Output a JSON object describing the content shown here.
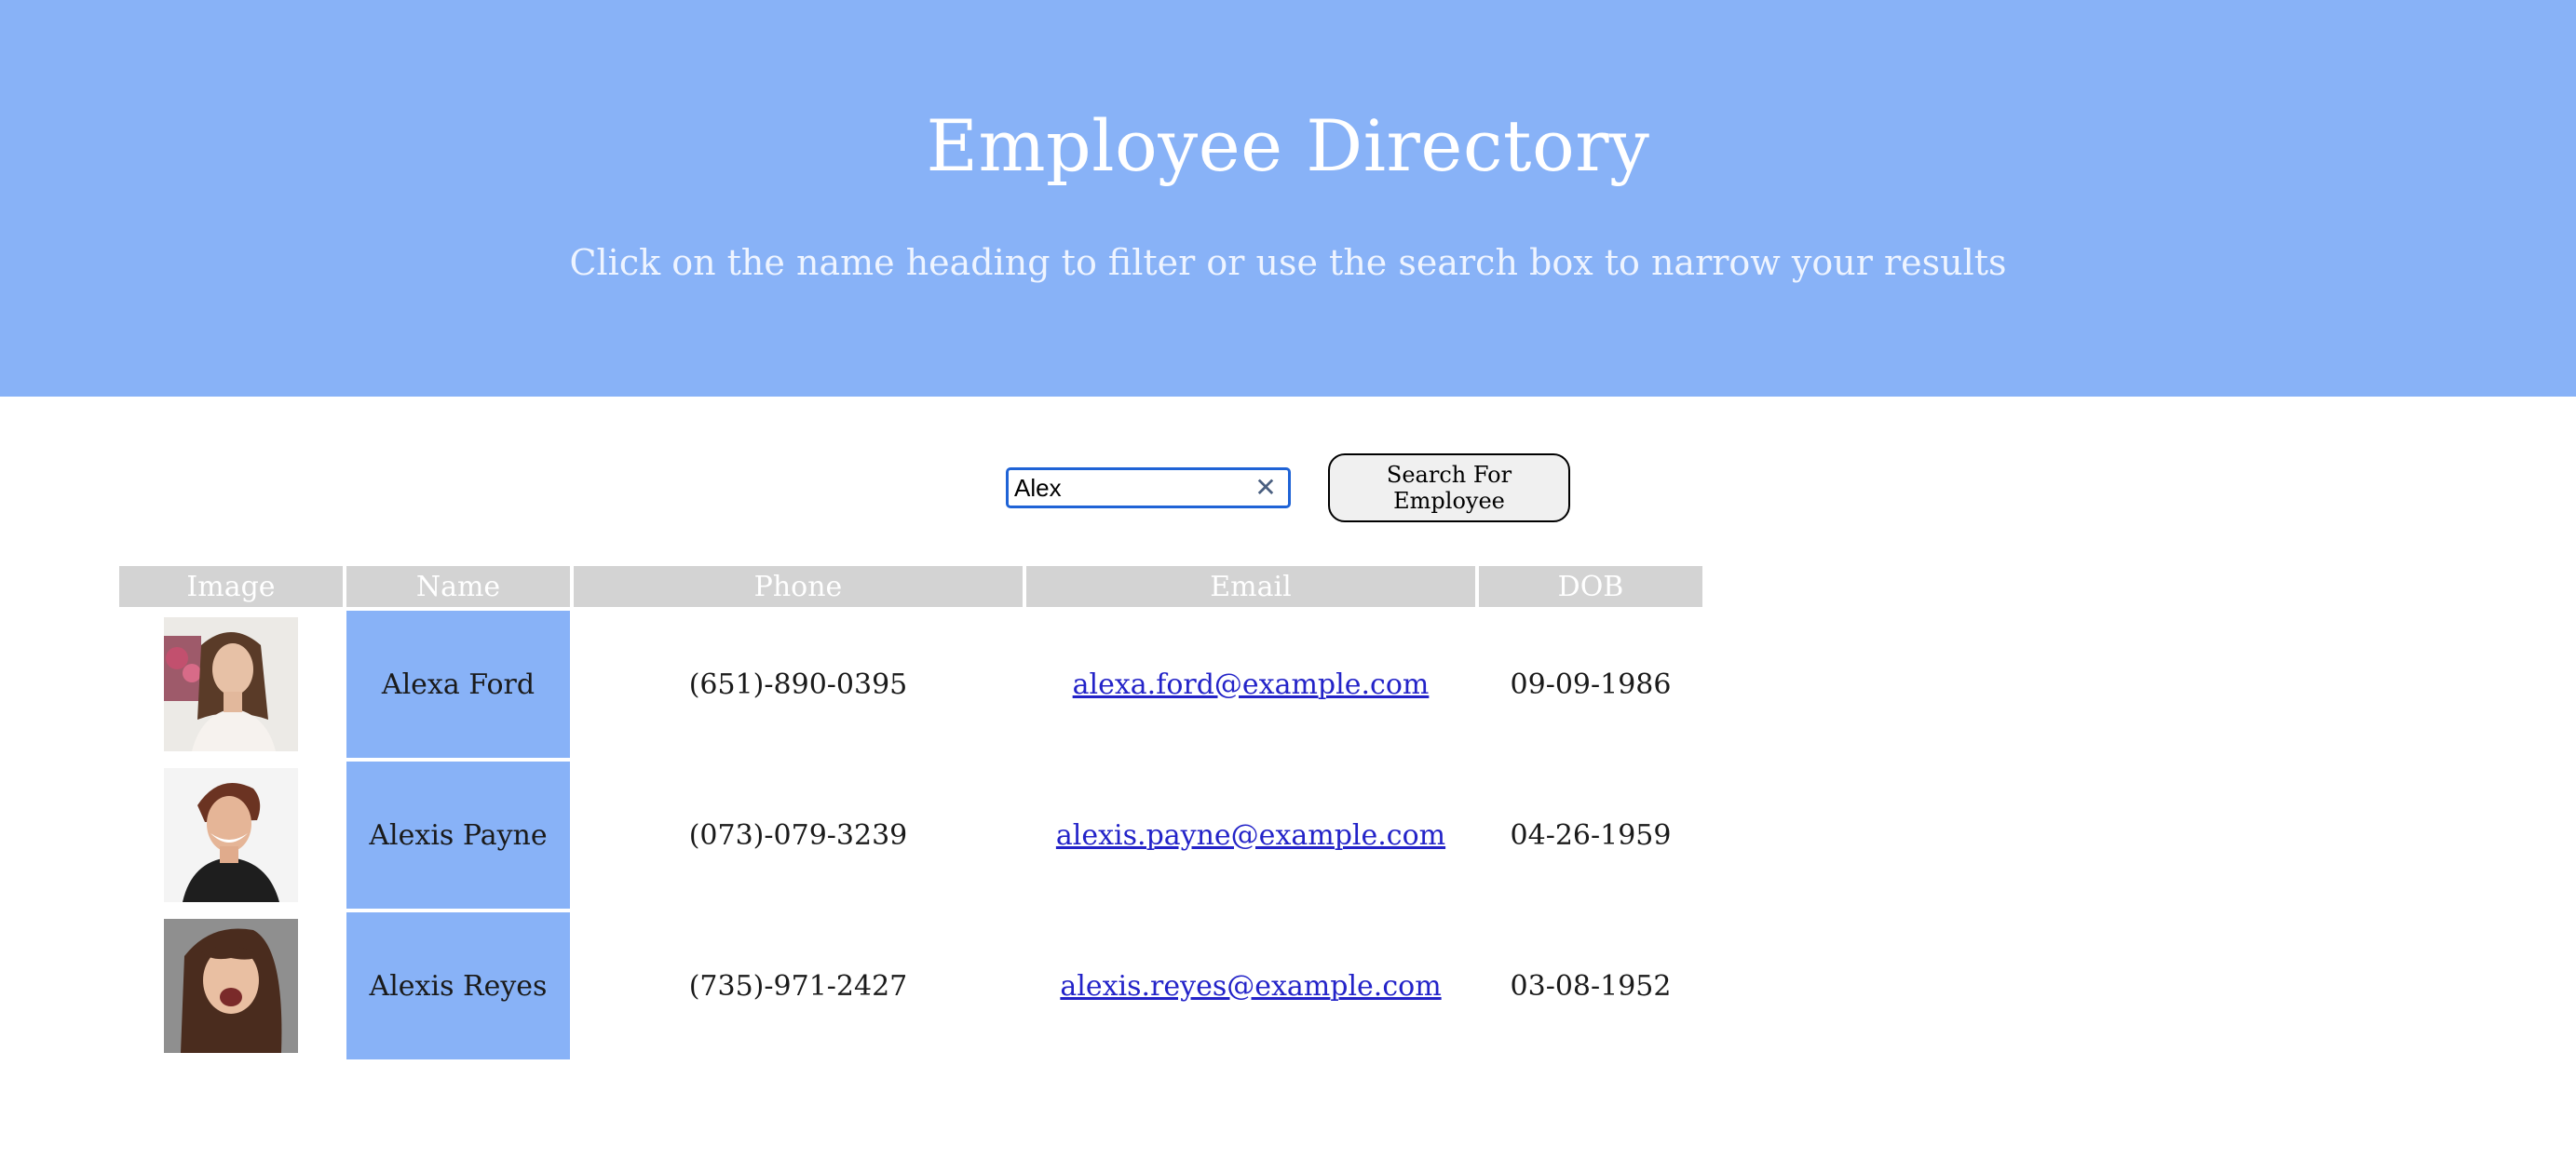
{
  "header": {
    "title": "Employee Directory",
    "subtitle": "Click on the name heading to filter or use the search box to narrow your results"
  },
  "search": {
    "value": "Alex",
    "clear_icon": "close-icon",
    "button_label": "Search For Employee"
  },
  "table": {
    "headers": [
      "Image",
      "Name",
      "Phone",
      "Email",
      "DOB"
    ],
    "rows": [
      {
        "name": "Alexa Ford",
        "phone": "(651)-890-0395",
        "email": "alexa.ford@example.com",
        "dob": "09-09-1986",
        "photo": "avatar-photo"
      },
      {
        "name": "Alexis Payne",
        "phone": "(073)-079-3239",
        "email": "alexis.payne@example.com",
        "dob": "04-26-1959",
        "photo": "avatar-photo"
      },
      {
        "name": "Alexis Reyes",
        "phone": "(735)-971-2427",
        "email": "alexis.reyes@example.com",
        "dob": "03-08-1952",
        "photo": "avatar-photo"
      }
    ]
  },
  "colors": {
    "hero_bg": "#88b2f7",
    "header_cell_bg": "#d3d3d3",
    "name_cell_bg": "#88b2f7",
    "link": "#2323c8",
    "focus_border": "#1f63d6"
  }
}
